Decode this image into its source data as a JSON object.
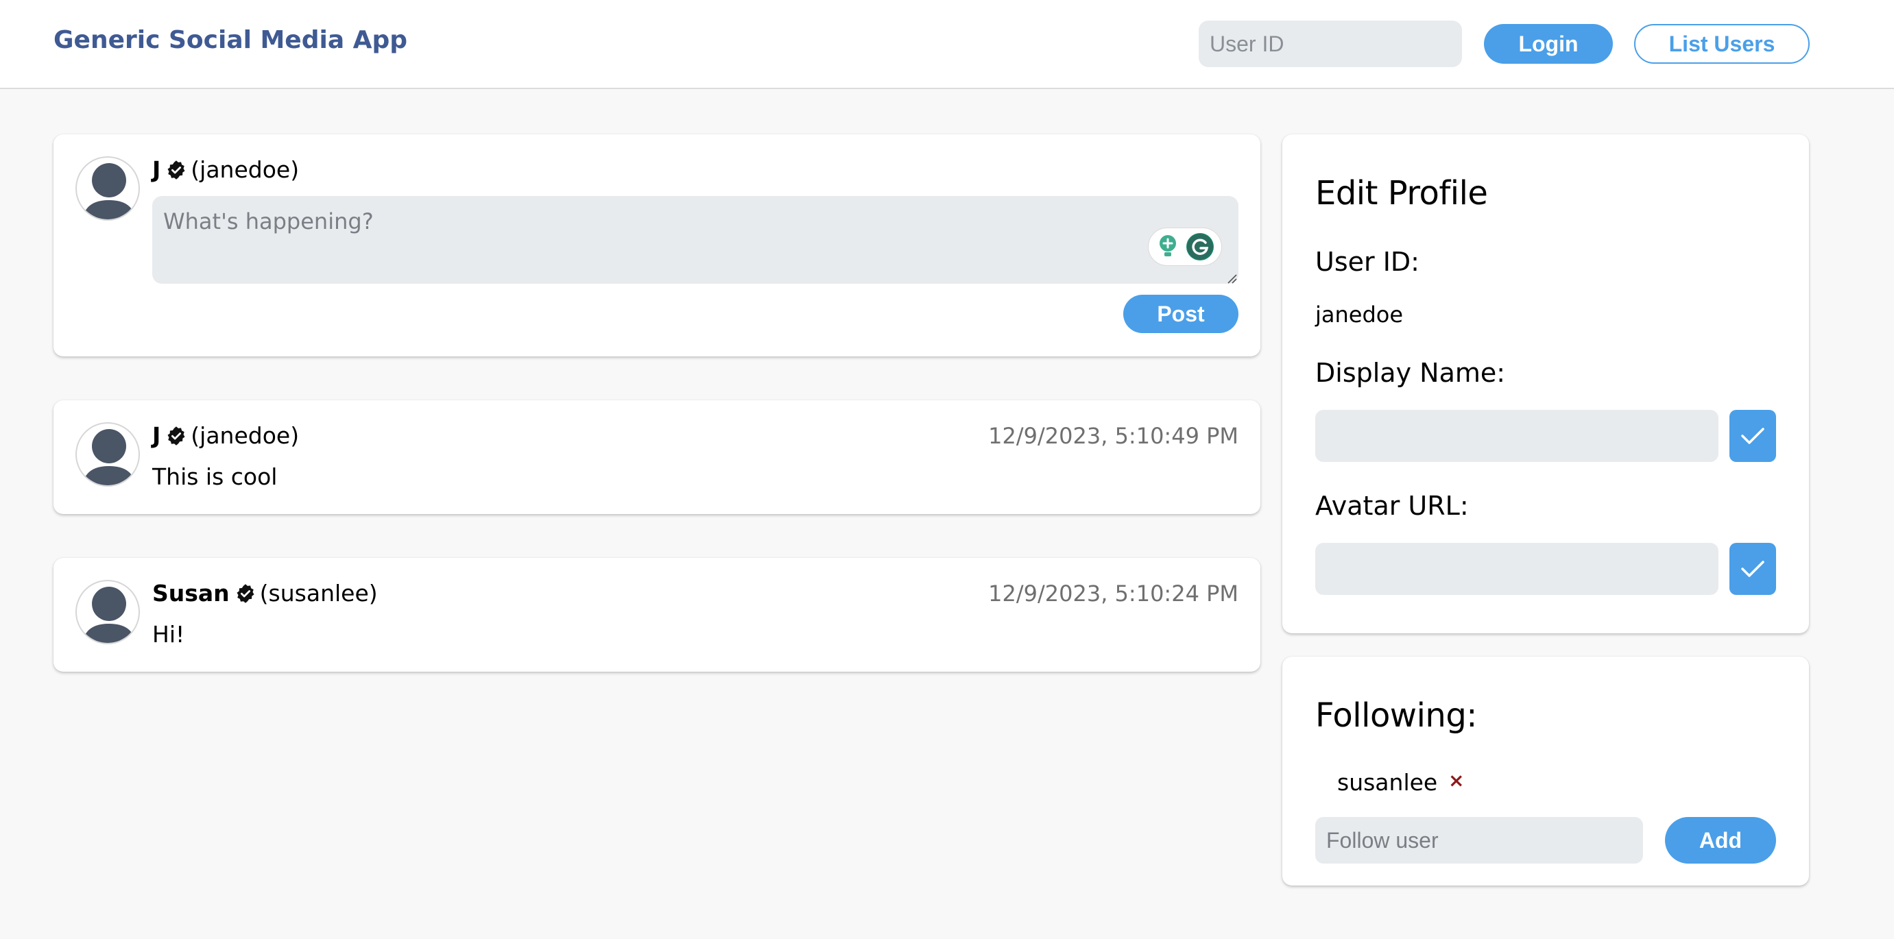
{
  "header": {
    "title": "Generic Social Media App",
    "user_id_placeholder": "User ID",
    "login_label": "Login",
    "list_users_label": "List Users"
  },
  "composer": {
    "display_name": "J",
    "handle": "(janedoe)",
    "placeholder": "What's happening?",
    "post_label": "Post"
  },
  "posts": [
    {
      "display_name": "J",
      "handle": "(janedoe)",
      "timestamp": "12/9/2023, 5:10:49 PM",
      "text": "This is cool"
    },
    {
      "display_name": "Susan",
      "handle": "(susanlee)",
      "timestamp": "12/9/2023, 5:10:24 PM",
      "text": "Hi!"
    }
  ],
  "edit_profile": {
    "title": "Edit Profile",
    "user_id_label": "User ID:",
    "user_id_value": "janedoe",
    "display_name_label": "Display Name:",
    "display_name_value": "",
    "avatar_url_label": "Avatar URL:",
    "avatar_url_value": ""
  },
  "following": {
    "title": "Following:",
    "users": [
      "susanlee"
    ],
    "remove_glyph": "×",
    "follow_placeholder": "Follow user",
    "add_label": "Add"
  },
  "colors": {
    "brand": "#3f5a93",
    "accent": "#4a9fe8",
    "input_bg": "#e8ebee",
    "avatar_fill": "#4a5566",
    "remove": "#8b1a1a"
  },
  "icons": {
    "verified": "verified-badge-icon",
    "avatar": "default-avatar-icon",
    "check": "checkmark-icon",
    "grammarly": "grammarly-icon",
    "lightbulb": "lightbulb-icon"
  }
}
